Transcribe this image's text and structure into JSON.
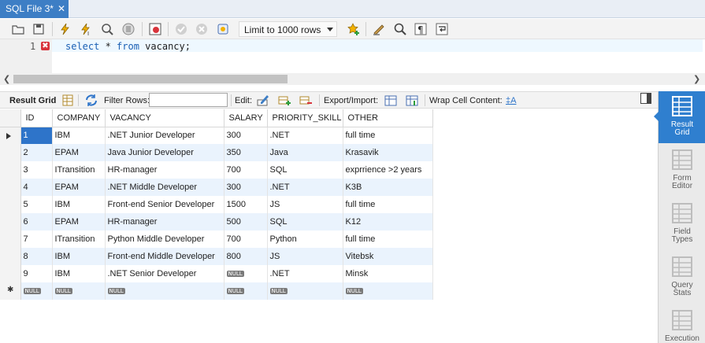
{
  "tab": {
    "title": "SQL File 3*",
    "close": "✕"
  },
  "toolbar": {
    "limit_label": "Limit to 1000 rows",
    "icons": [
      "open-folder-icon",
      "save-icon",
      "execute-icon",
      "execute-current-icon",
      "explain-icon",
      "stop-icon",
      "toggle-error-icon",
      "commit-icon",
      "rollback-icon",
      "autocommit-icon",
      "limit-select",
      "add-snippet-icon",
      "beautify-icon",
      "find-icon",
      "invisible-chars-icon",
      "wrap-icon"
    ]
  },
  "editor": {
    "line_number": "1",
    "error_marker": "✖",
    "code": {
      "kw1": "select",
      "mid": " * ",
      "kw2": "from",
      "rest": " vacancy;"
    }
  },
  "result_toolbar": {
    "result_grid": "Result Grid",
    "filter_rows": "Filter Rows:",
    "edit": "Edit:",
    "export_import": "Export/Import:",
    "wrap_cell": "Wrap Cell Content:",
    "wrap_icon_text": "‡A"
  },
  "grid": {
    "columns": [
      "ID",
      "COMPANY",
      "VACANCY",
      "SALARY",
      "PRIORITY_SKILL",
      "OTHER"
    ],
    "rows": [
      [
        "1",
        "IBM",
        ".NET Junior Developer",
        "300",
        ".NET",
        "full time"
      ],
      [
        "2",
        "EPAM",
        "Java Junior Developer",
        "350",
        "Java",
        "Krasavik"
      ],
      [
        "3",
        "ITransition",
        "HR-manager",
        "700",
        "SQL",
        "exprrience >2 years"
      ],
      [
        "4",
        "EPAM",
        ".NET Middle Developer",
        "300",
        ".NET",
        "K3B"
      ],
      [
        "5",
        "IBM",
        "Front-end Senior Developer",
        "1500",
        "JS",
        "full time"
      ],
      [
        "6",
        "EPAM",
        "HR-manager",
        "500",
        "SQL",
        "K12"
      ],
      [
        "7",
        "ITransition",
        "Python Middle Developer",
        "700",
        "Python",
        "full time"
      ],
      [
        "8",
        "IBM",
        "Front-end Middle Developer",
        "800",
        "JS",
        "Vitebsk"
      ],
      [
        "9",
        "IBM",
        ".NET Senior Developer",
        "NULL",
        ".NET",
        "Minsk"
      ]
    ],
    "null_label": "NULL",
    "new_row_marker": "✱"
  },
  "sidepanel": {
    "items": [
      {
        "label1": "Result",
        "label2": "Grid",
        "active": true
      },
      {
        "label1": "Form",
        "label2": "Editor",
        "active": false
      },
      {
        "label1": "Field",
        "label2": "Types",
        "active": false
      },
      {
        "label1": "Query",
        "label2": "Stats",
        "active": false
      },
      {
        "label1": "Execution",
        "label2": "",
        "active": false
      }
    ]
  },
  "colors": {
    "accent": "#2f7fcf",
    "selection": "#2e74c9",
    "alt_row": "#eaf3fd",
    "keyword": "#1a5fb4",
    "error": "#d8333b"
  }
}
